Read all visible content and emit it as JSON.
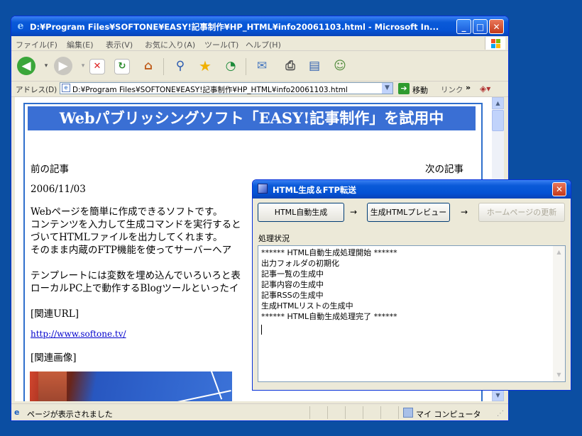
{
  "browser": {
    "title": "D:¥Program Files¥SOFTONE¥EASY!記事制作¥HP_HTML¥info20061103.html - Microsoft In...",
    "menu": [
      "ファイル(F)",
      "編集(E)",
      "表示(V)",
      "お気に入り(A)",
      "ツール(T)",
      "ヘルプ(H)"
    ],
    "address_label": "アドレス(D)",
    "address": "D:¥Program Files¥SOFTONE¥EASY!記事制作¥HP_HTML¥info20061103.html",
    "go_label": "移動",
    "links_label": "リンク",
    "status_text": "ページが表示されました",
    "zone_text": "マイ コンピュータ"
  },
  "page": {
    "header": "Webパブリッシングソフト「EASY!記事制作」を試用中",
    "prev": "前の記事",
    "next": "次の記事",
    "date": "2006/11/03",
    "para1": [
      "Webページを簡単に作成できるソフトです。",
      "コンテンツを入力して生成コマンドを実行すると",
      "づいてHTMLファイルを出力してくれます。",
      "そのまま内蔵のFTP機能を使ってサーバーへア"
    ],
    "para2": [
      "テンプレートには変数を埋め込んでいろいろと表",
      "ローカルPC上で動作するBlogツールといったイ"
    ],
    "related_url_label": "[関連URL]",
    "related_url": "http://www.softone.tv/",
    "related_image_label": "[関連画像]"
  },
  "dialog": {
    "title": "HTML生成＆FTP転送",
    "buttons": [
      "HTML自動生成",
      "生成HTMLプレビュー",
      "ホームページの更新"
    ],
    "arrow": "→",
    "status_label": "処理状況",
    "log": [
      "****** HTML自動生成処理開始 ******",
      "出力フォルダの初期化",
      "記事一覧の生成中",
      "記事内容の生成中",
      "記事RSSの生成中",
      "生成HTMLリストの生成中",
      "****** HTML自動生成処理完了 ******"
    ]
  }
}
